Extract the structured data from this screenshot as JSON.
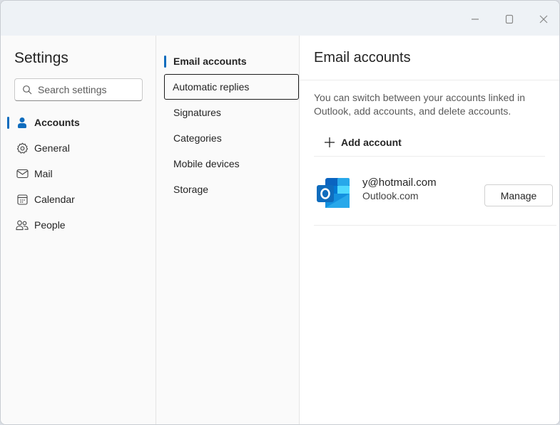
{
  "window": {
    "controls": {
      "minimize": "minimize",
      "maximize": "maximize",
      "close": "close"
    }
  },
  "sidebar": {
    "title": "Settings",
    "search_placeholder": "Search settings",
    "items": [
      {
        "label": "Accounts",
        "icon": "person-icon",
        "active": true
      },
      {
        "label": "General",
        "icon": "gear-icon",
        "active": false
      },
      {
        "label": "Mail",
        "icon": "mail-icon",
        "active": false
      },
      {
        "label": "Calendar",
        "icon": "calendar-icon",
        "active": false
      },
      {
        "label": "People",
        "icon": "people-icon",
        "active": false
      }
    ]
  },
  "subnav": {
    "items": [
      {
        "label": "Email accounts",
        "active": true
      },
      {
        "label": "Automatic replies",
        "focused": true
      },
      {
        "label": "Signatures"
      },
      {
        "label": "Categories"
      },
      {
        "label": "Mobile devices"
      },
      {
        "label": "Storage"
      }
    ]
  },
  "pane": {
    "title": "Email accounts",
    "description": "You can switch between your accounts linked in Outlook, add accounts, and delete accounts.",
    "add_account_label": "Add account",
    "accounts": [
      {
        "email_visible": "y@hotmail.com",
        "provider": "Outlook.com",
        "manage_label": "Manage",
        "icon": "outlook-logo-icon"
      }
    ]
  },
  "colors": {
    "accent": "#0f6cbd",
    "outlook_blue": "#0a64c0"
  }
}
